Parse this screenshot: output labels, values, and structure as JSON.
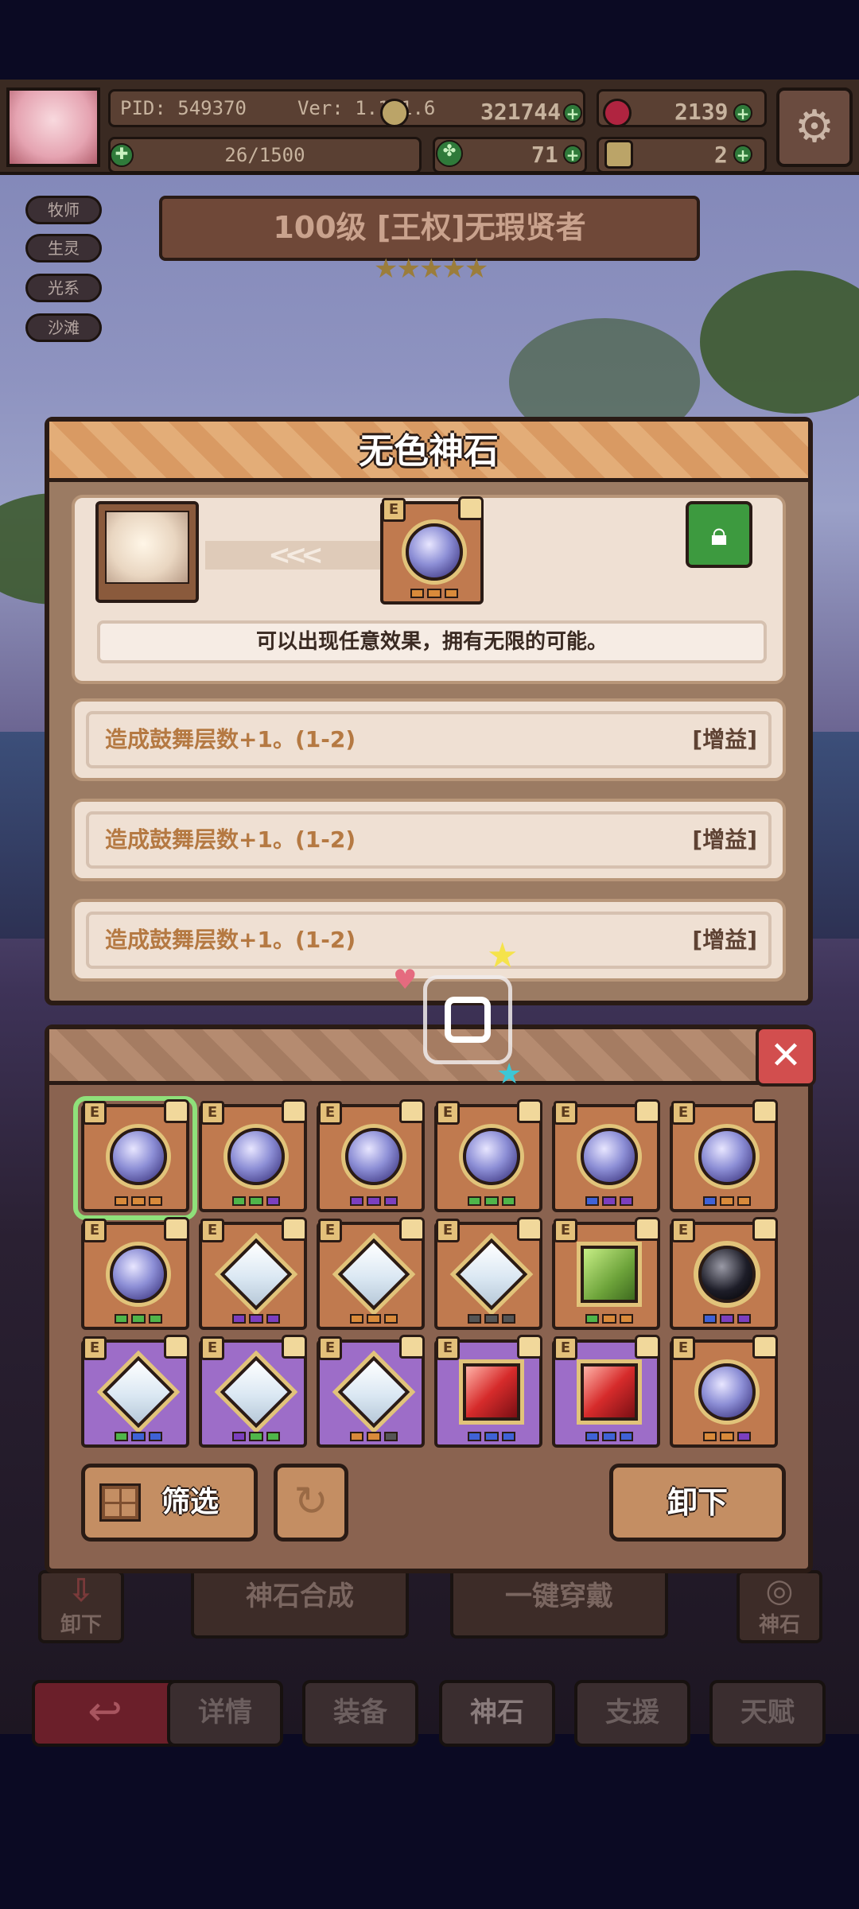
{
  "hud": {
    "pid": "PID: 549370",
    "version": "Ver: 1.1.1.6",
    "gold": "321744",
    "gems": "2139",
    "stamina": "26/1500",
    "clover": "71",
    "keys": "2"
  },
  "tags": [
    "牧师",
    "生灵",
    "光系",
    "沙滩"
  ],
  "hero": {
    "title": "100级 [王权]无瑕贤者",
    "stars": "★★★★★"
  },
  "dialog": {
    "title": "无色神石",
    "arrows": "<<<",
    "description": "可以出现任意效果，拥有无限的可能。",
    "effects": [
      {
        "text": "造成鼓舞层数+1。(1-2)",
        "tag": "[增益]"
      },
      {
        "text": "造成鼓舞层数+1。(1-2)",
        "tag": "[增益]"
      },
      {
        "text": "造成鼓舞层数+1。(1-2)",
        "tag": "[增益]"
      }
    ]
  },
  "inventory": {
    "close": "✕",
    "filter_label": "筛选",
    "unequip_label": "卸下",
    "slot_badge": "E",
    "slots": [
      {
        "bg": "orange",
        "gem": "gem-round",
        "dots": [
          "#d98a3a",
          "#d98a3a",
          "#d98a3a"
        ],
        "selected": true
      },
      {
        "bg": "orange",
        "gem": "gem-round",
        "dots": [
          "#4fb54a",
          "#4fb54a",
          "#7b3fbf"
        ]
      },
      {
        "bg": "orange",
        "gem": "gem-round",
        "dots": [
          "#7b3fbf",
          "#7b3fbf",
          "#7b3fbf"
        ]
      },
      {
        "bg": "orange",
        "gem": "gem-round",
        "dots": [
          "#4fb54a",
          "#4fb54a",
          "#4fb54a"
        ]
      },
      {
        "bg": "orange",
        "gem": "gem-round",
        "dots": [
          "#3f62d6",
          "#7b3fbf",
          "#7b3fbf"
        ]
      },
      {
        "bg": "orange",
        "gem": "gem-round",
        "dots": [
          "#3f62d6",
          "#d98a3a",
          "#d98a3a"
        ]
      },
      {
        "bg": "orange",
        "gem": "gem-round",
        "dots": [
          "#4fb54a",
          "#4fb54a",
          "#4fb54a"
        ]
      },
      {
        "bg": "orange",
        "gem": "gem-diamond",
        "dots": [
          "#7b3fbf",
          "#7b3fbf",
          "#7b3fbf"
        ]
      },
      {
        "bg": "orange",
        "gem": "gem-diamond",
        "dots": [
          "#d98a3a",
          "#d98a3a",
          "#d98a3a"
        ]
      },
      {
        "bg": "orange",
        "gem": "gem-diamond",
        "dots": [
          "#555",
          "#555",
          "#555"
        ]
      },
      {
        "bg": "orange",
        "gem": "gem-green",
        "dots": [
          "#4fb54a",
          "#d98a3a",
          "#d98a3a"
        ]
      },
      {
        "bg": "orange",
        "gem": "gem-black",
        "dots": [
          "#3f62d6",
          "#7b3fbf",
          "#7b3fbf"
        ]
      },
      {
        "bg": "purple",
        "gem": "gem-diamond",
        "dots": [
          "#4fb54a",
          "#3f62d6",
          "#3f62d6"
        ]
      },
      {
        "bg": "purple",
        "gem": "gem-diamond",
        "dots": [
          "#7b3fbf",
          "#4fb54a",
          "#4fb54a"
        ]
      },
      {
        "bg": "purple",
        "gem": "gem-diamond",
        "dots": [
          "#d98a3a",
          "#d98a3a",
          "#555"
        ]
      },
      {
        "bg": "purple",
        "gem": "gem-red",
        "dots": [
          "#3f62d6",
          "#3f62d6",
          "#3f62d6"
        ]
      },
      {
        "bg": "purple",
        "gem": "gem-red",
        "dots": [
          "#3f62d6",
          "#3f62d6",
          "#3f62d6"
        ]
      },
      {
        "bg": "orange",
        "gem": "gem-round",
        "dots": [
          "#d98a3a",
          "#d98a3a",
          "#7b3fbf"
        ]
      }
    ]
  },
  "bottom": {
    "unequip": "卸下",
    "synthesis": "神石合成",
    "equip_all": "一键穿戴",
    "stone": "神石",
    "tabs": [
      "详情",
      "装备",
      "神石",
      "支援",
      "天赋"
    ]
  }
}
